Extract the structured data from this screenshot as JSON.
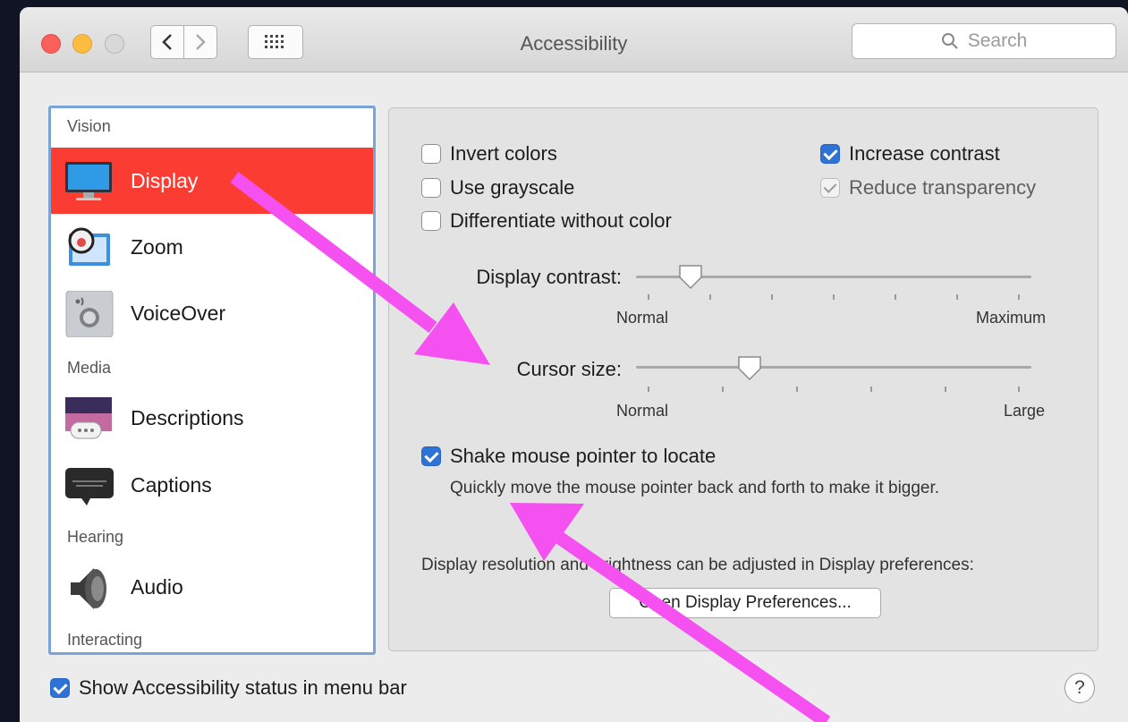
{
  "window": {
    "title": "Accessibility",
    "search_placeholder": "Search"
  },
  "sidebar": {
    "sections": [
      "Vision",
      "Media",
      "Hearing",
      "Interacting"
    ],
    "items": [
      {
        "label": "Display",
        "icon": "display-icon",
        "selected": true
      },
      {
        "label": "Zoom",
        "icon": "zoom-icon"
      },
      {
        "label": "VoiceOver",
        "icon": "voiceover-icon"
      },
      {
        "label": "Descriptions",
        "icon": "descriptions-icon"
      },
      {
        "label": "Captions",
        "icon": "captions-icon"
      },
      {
        "label": "Audio",
        "icon": "audio-icon"
      }
    ]
  },
  "display_panel": {
    "invert_colors": {
      "label": "Invert colors",
      "checked": false
    },
    "use_grayscale": {
      "label": "Use grayscale",
      "checked": false
    },
    "differentiate": {
      "label": "Differentiate without color",
      "checked": false
    },
    "increase_contrast": {
      "label": "Increase contrast",
      "checked": true
    },
    "reduce_transparency": {
      "label": "Reduce transparency",
      "checked": true,
      "disabled": true
    },
    "display_contrast": {
      "label": "Display contrast:",
      "min_label": "Normal",
      "max_label": "Maximum",
      "value_fraction": 0.14
    },
    "cursor_size": {
      "label": "Cursor size:",
      "min_label": "Normal",
      "max_label": "Large",
      "value_fraction": 0.29
    },
    "shake_pointer": {
      "label": "Shake mouse pointer to locate",
      "checked": true,
      "description": "Quickly move the mouse pointer back and forth to make it bigger."
    },
    "resolution_note": "Display resolution and brightness can be adjusted in Display preferences:",
    "open_button": "Open Display Preferences..."
  },
  "footer": {
    "show_status": {
      "label": "Show Accessibility status in menu bar",
      "checked": true
    },
    "help_label": "?"
  },
  "colors": {
    "selection": "#fa3c32",
    "checkbox_blue": "#2f72d6",
    "annotation_arrow": "#f550f0"
  }
}
